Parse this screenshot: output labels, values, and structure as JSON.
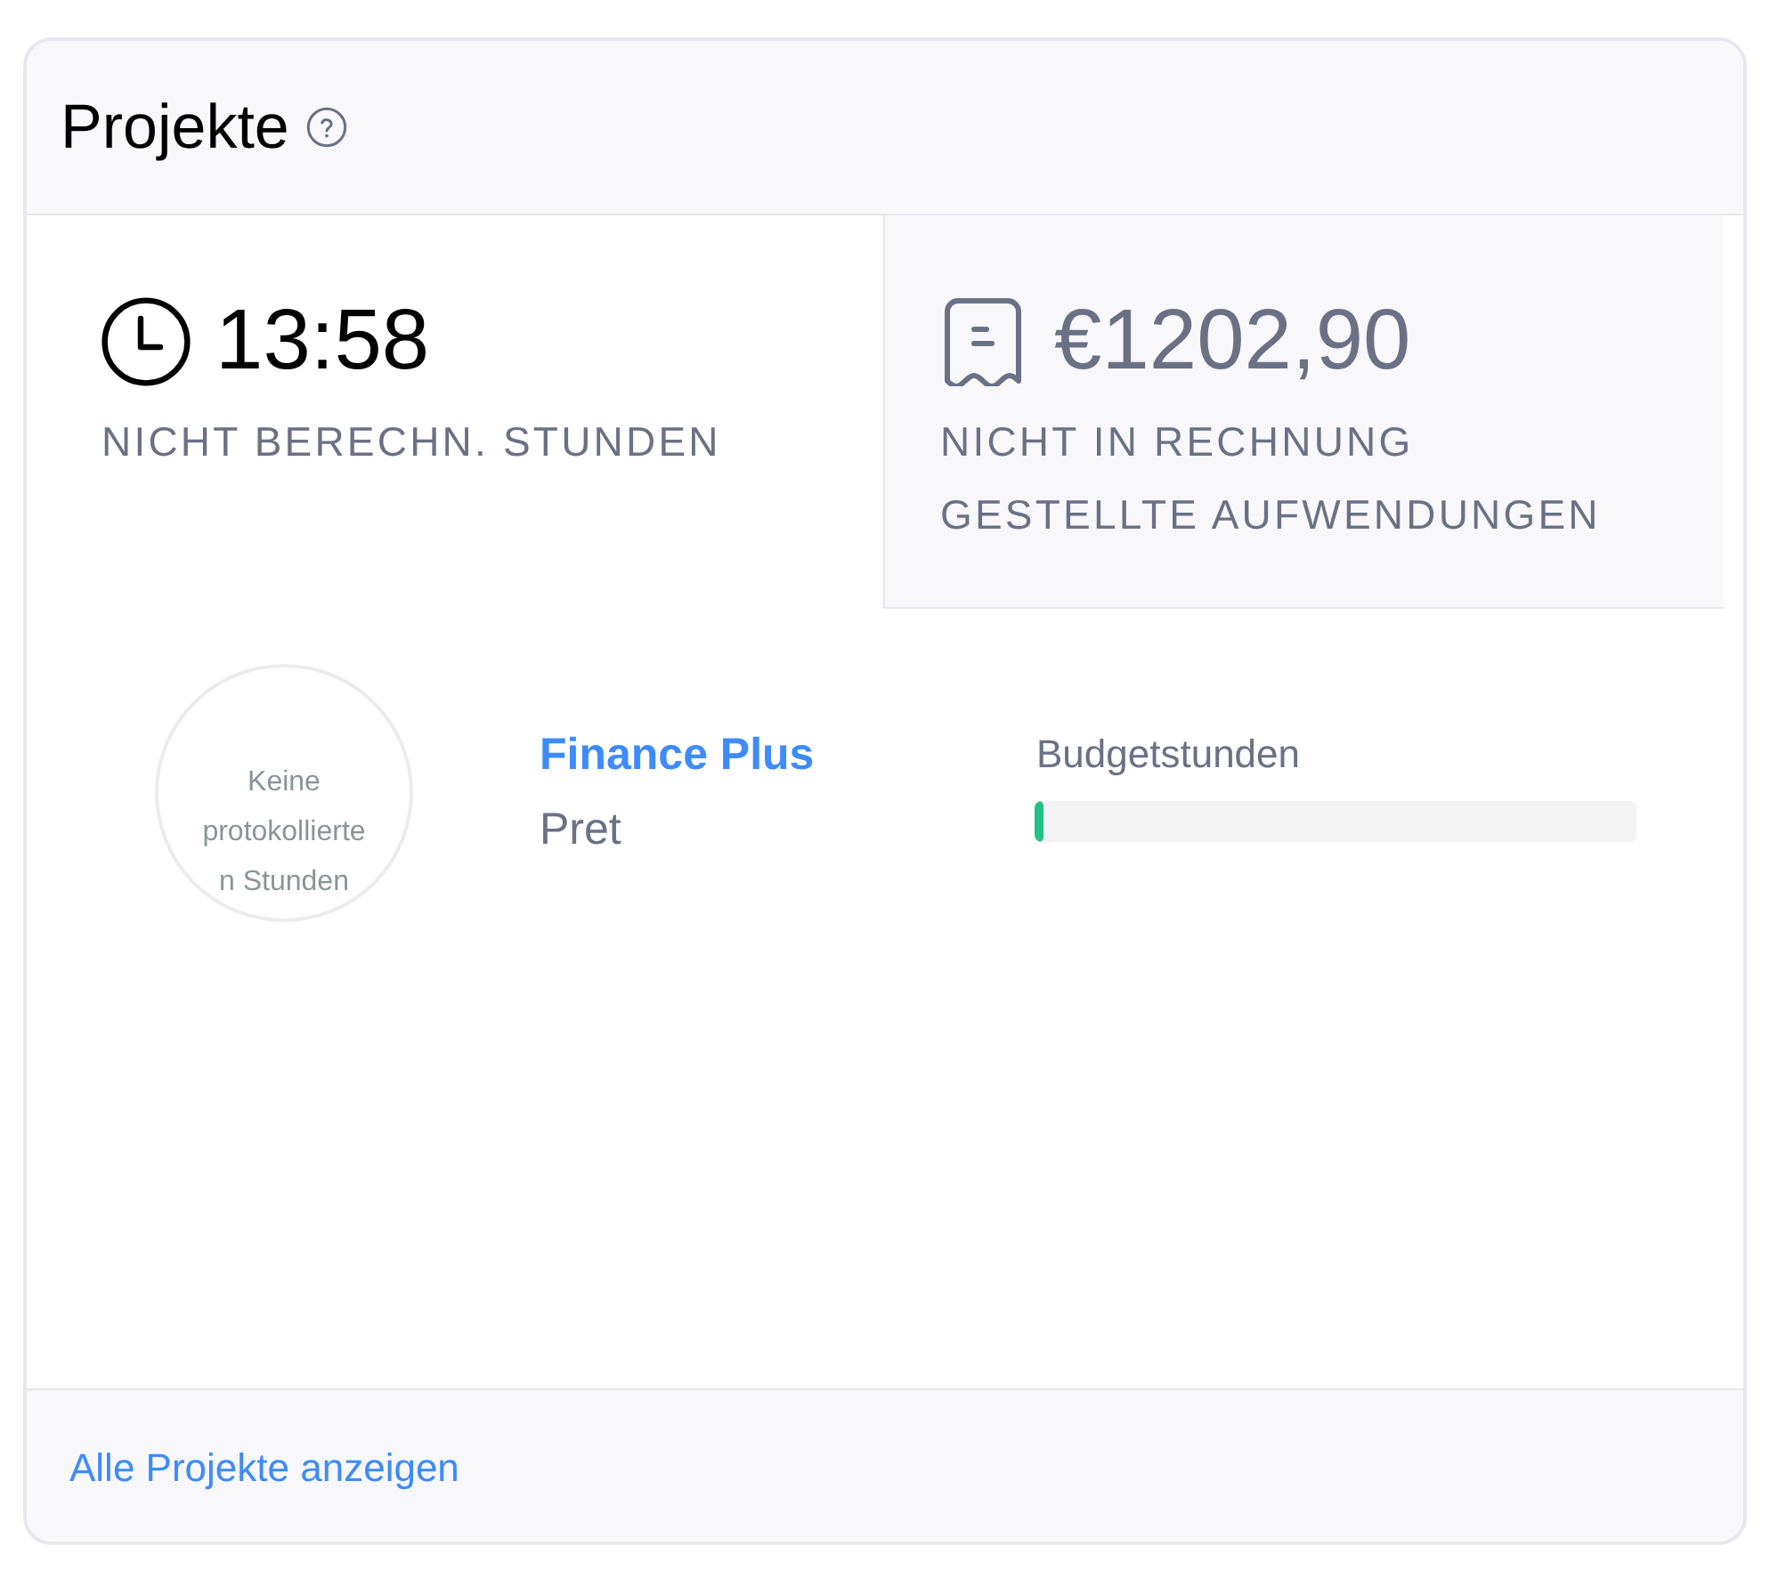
{
  "header": {
    "title": "Projekte"
  },
  "stats": [
    {
      "kind": "time",
      "value": "13:58",
      "label": "NICHT BERECHN. STUNDEN"
    },
    {
      "kind": "expense",
      "value": "€1202,90",
      "label": "NICHT IN RECHNUNG GESTELLTE AUFWENDUNGEN"
    }
  ],
  "projects": [
    {
      "ring_text": "Keine protokollierten Stunden",
      "name": "Finance Plus",
      "client": "Pret",
      "budget": {
        "label": "Budgetstunden",
        "level": 0.015
      }
    }
  ],
  "footer": {
    "link": "Alle Projekte anzeigen"
  }
}
